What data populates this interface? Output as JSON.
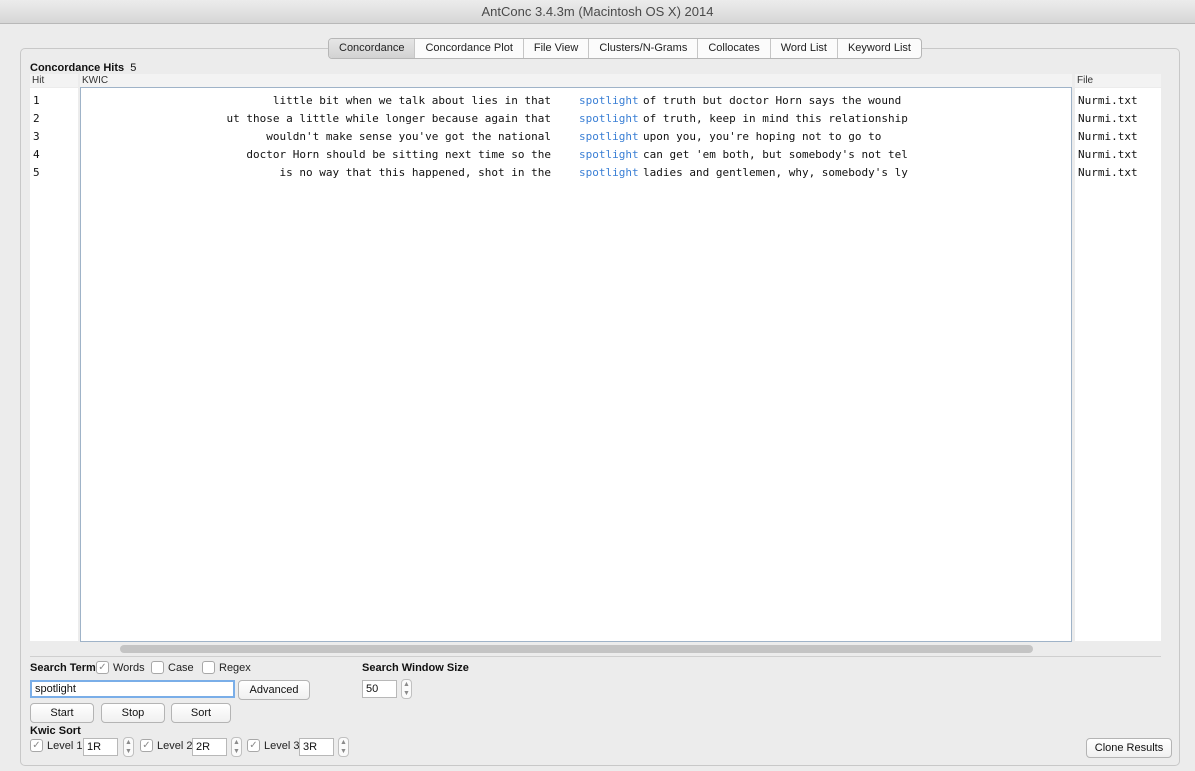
{
  "window": {
    "title": "AntConc 3.4.3m (Macintosh OS X) 2014"
  },
  "tabs": [
    {
      "label": "Concordance",
      "active": true
    },
    {
      "label": "Concordance Plot",
      "active": false
    },
    {
      "label": "File View",
      "active": false
    },
    {
      "label": "Clusters/N-Grams",
      "active": false
    },
    {
      "label": "Collocates",
      "active": false
    },
    {
      "label": "Word List",
      "active": false
    },
    {
      "label": "Keyword List",
      "active": false
    }
  ],
  "concordance": {
    "hits_label": "Concordance Hits",
    "hits_count": "5",
    "headers": {
      "hit": "Hit",
      "kwic": "KWIC",
      "file": "File"
    },
    "rows": [
      {
        "hit": "1",
        "left": "little bit when we talk about lies in that",
        "node": "spotlight",
        "right": "of truth but doctor Horn says the wound",
        "file": "Nurmi.txt"
      },
      {
        "hit": "2",
        "left": "ut those a little while longer because again that",
        "node": "spotlight",
        "right": "of truth, keep in mind this relationship",
        "file": "Nurmi.txt"
      },
      {
        "hit": "3",
        "left": "wouldn't make sense you've got the national",
        "node": "spotlight",
        "right": "upon you, you're hoping not to go to",
        "file": "Nurmi.txt"
      },
      {
        "hit": "4",
        "left": "doctor Horn should be sitting next time so the",
        "node": "spotlight",
        "right": "can get 'em both, but somebody's not tel",
        "file": "Nurmi.txt"
      },
      {
        "hit": "5",
        "left": "is no way that this happened, shot in the",
        "node": "spotlight",
        "right": "ladies and gentlemen, why, somebody's ly",
        "file": "Nurmi.txt"
      }
    ]
  },
  "search": {
    "term_label": "Search Term",
    "words_label": "Words",
    "words_checked": true,
    "case_label": "Case",
    "case_checked": false,
    "regex_label": "Regex",
    "regex_checked": false,
    "term_value": "spotlight",
    "advanced_label": "Advanced",
    "window_size_label": "Search Window Size",
    "window_size_value": "50",
    "start_label": "Start",
    "stop_label": "Stop",
    "sort_label": "Sort"
  },
  "kwic_sort": {
    "label": "Kwic Sort",
    "levels": [
      {
        "label": "Level 1",
        "value": "1R",
        "checked": true
      },
      {
        "label": "Level 2",
        "value": "2R",
        "checked": true
      },
      {
        "label": "Level 3",
        "value": "3R",
        "checked": true
      }
    ]
  },
  "clone_results_label": "Clone Results",
  "colors": {
    "node_word": "#3a7fd5",
    "focus_ring": "#7aaee8"
  }
}
